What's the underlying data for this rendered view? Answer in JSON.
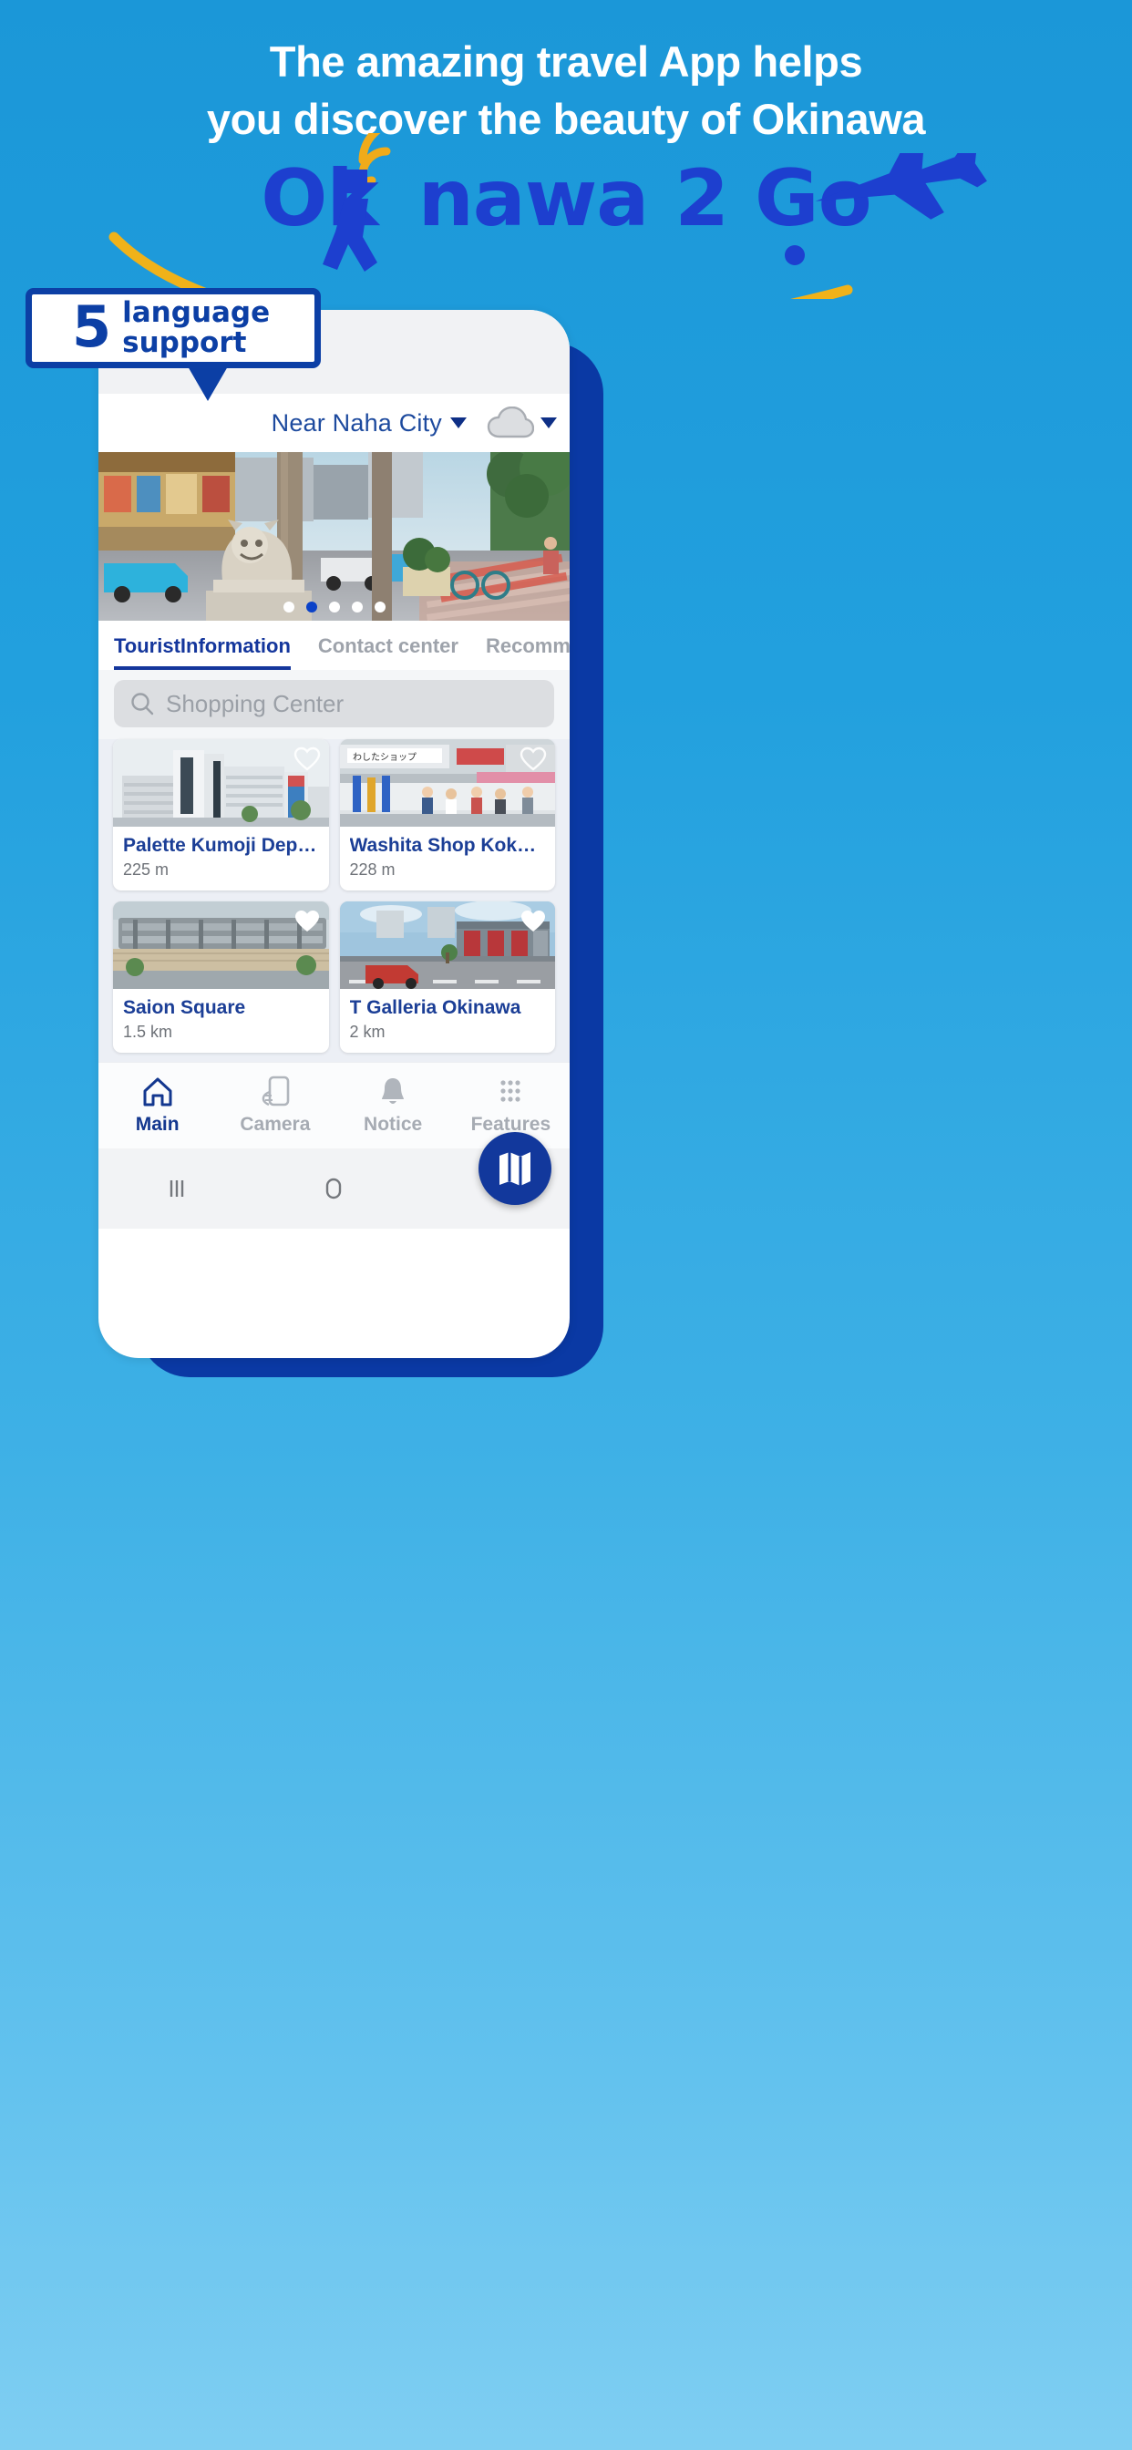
{
  "promo": {
    "headline_line1": "The amazing travel App helps",
    "headline_line2": "you discover the beauty of Okinawa",
    "logo_part1": "Ok",
    "logo_part2": "nawa 2 Go",
    "logo_full": "Okinawa 2 Go",
    "badge_number": "5",
    "badge_line1": "language",
    "badge_line2": "support",
    "colors": {
      "background_top": "#1b97d8",
      "background_bottom": "#7fcef2",
      "logo_blue": "#1d3fcf",
      "badge_blue": "#0c3fa5",
      "accent_yellow": "#f0ab1a",
      "phone_shadow_blue": "#0a39a4"
    }
  },
  "app": {
    "header": {
      "location": "Near Naha City",
      "location_dropdown_icon": "chevron-down-icon",
      "weather_icon": "cloud-icon",
      "weather_dropdown_icon": "chevron-down-icon"
    },
    "carousel": {
      "total_dots": 5,
      "active_index": 1
    },
    "tabs": [
      {
        "label": "TouristInformation",
        "active": true
      },
      {
        "label": "Contact center",
        "active": false
      },
      {
        "label": "Recommended",
        "active": false
      }
    ],
    "search": {
      "icon": "search-icon",
      "placeholder": "Shopping Center",
      "value": ""
    },
    "places": [
      {
        "name": "Palette Kumoji Departmen...",
        "distance": "225 m",
        "favorite": false,
        "image": "department-store-building"
      },
      {
        "name": "Washita Shop Kokusai Str...",
        "distance": "228 m",
        "favorite": false,
        "image": "shopping-street-storefront"
      },
      {
        "name": "Saion Square",
        "distance": "1.5 km",
        "favorite": true,
        "image": "saion-square-building"
      },
      {
        "name": "T Galleria Okinawa",
        "distance": "2 km",
        "favorite": true,
        "image": "t-galleria-building"
      }
    ],
    "map_fab": {
      "icon": "map-icon",
      "label": "Map"
    },
    "bottom_nav": [
      {
        "label": "Main",
        "icon": "home-icon",
        "active": true
      },
      {
        "label": "Camera",
        "icon": "phone-camera-icon",
        "active": false
      },
      {
        "label": "Notice",
        "icon": "bell-icon",
        "active": false
      },
      {
        "label": "Features",
        "icon": "grid-dots-icon",
        "active": false
      }
    ],
    "system_nav": [
      {
        "name": "recents-button",
        "icon": "three-bars-icon"
      },
      {
        "name": "home-button",
        "icon": "rounded-square-icon"
      },
      {
        "name": "back-button",
        "icon": "chevron-left-icon"
      }
    ]
  }
}
